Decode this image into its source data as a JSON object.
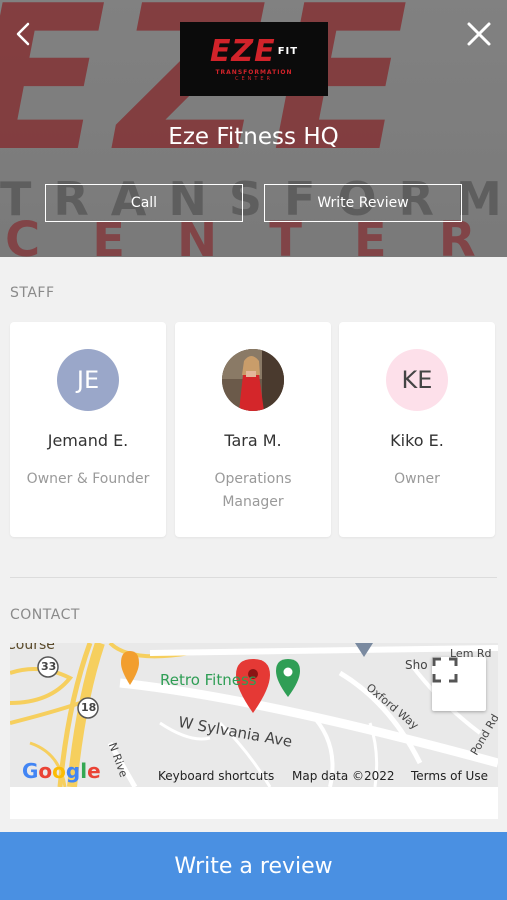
{
  "header": {
    "business_name": "Eze Fitness HQ",
    "logo": {
      "main": "EZE",
      "fit": "FIT",
      "sub": "TRANSFORMATION",
      "sub2": "CENTER"
    },
    "background_words": {
      "big": "EZE",
      "mid": "TRANSFORMATION",
      "low": "CENTER"
    },
    "call_label": "Call",
    "write_review_label": "Write Review",
    "back_icon": "chevron-left-icon",
    "close_icon": "close-icon"
  },
  "staff": {
    "title": "STAFF",
    "members": [
      {
        "initials": "JE",
        "name": "Jemand E.",
        "role": "Owner & Founder",
        "avatar_color": "#9aa7c9",
        "text_color": "#ffffff"
      },
      {
        "initials": "",
        "name": "Tara M.",
        "role": "Operations Manager",
        "avatar_color": "#8a3b2e",
        "text_color": "#ffffff"
      },
      {
        "initials": "KE",
        "name": "Kiko E.",
        "role": "Owner",
        "avatar_color": "#fde0ea",
        "text_color": "#444444"
      }
    ]
  },
  "contact": {
    "title": "CONTACT",
    "map": {
      "labels": {
        "retro": "Retro Fitness",
        "sylvania": "W Sylvania Ave",
        "oxford": "Oxford Way",
        "pond": "Pond Rd",
        "sho": "Sho",
        "lem": "Lem Rd",
        "nriv": "N Rive",
        "course": "Course",
        "r33": "33",
        "r18": "18"
      },
      "google": "Google",
      "keyboard_shortcuts": "Keyboard shortcuts",
      "map_data": "Map data ©2022",
      "terms": "Terms of Use"
    }
  },
  "bottom": {
    "write_review_label": "Write a review"
  },
  "colors": {
    "accent": "#4a90e2",
    "brand_red": "#d2232a"
  }
}
